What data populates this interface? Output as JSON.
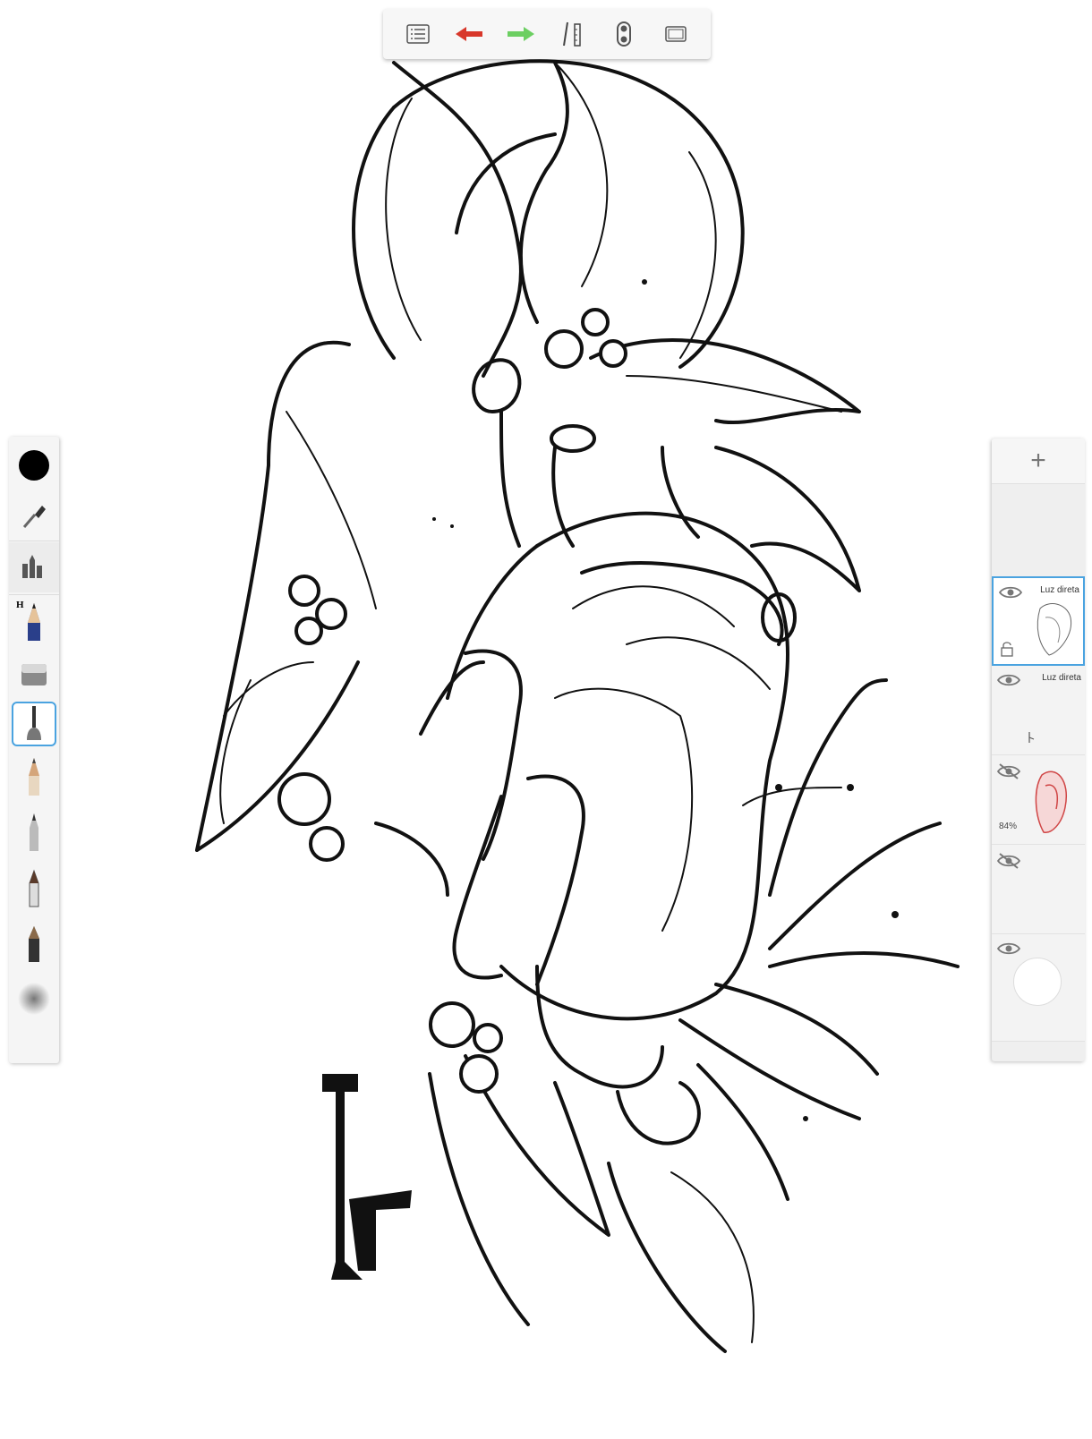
{
  "app": {
    "accent_color": "#4aa3e0"
  },
  "top_toolbar": {
    "buttons": [
      {
        "name": "list-icon"
      },
      {
        "name": "undo-arrow-icon",
        "color": "#d8372a"
      },
      {
        "name": "redo-arrow-icon",
        "color": "#6ccf62"
      },
      {
        "name": "ruler-icon"
      },
      {
        "name": "symmetry-icon"
      },
      {
        "name": "fullscreen-icon"
      }
    ]
  },
  "left_palette": {
    "color_swatch": "#000000",
    "pencil_hardness_label": "H"
  },
  "layers": [
    {
      "name": "Luz direta",
      "visible": true,
      "selected": true,
      "opacity": ""
    },
    {
      "name": "Luz direta",
      "visible": true,
      "selected": false,
      "opacity": ""
    },
    {
      "name": "",
      "visible": false,
      "selected": false,
      "opacity": "84%"
    },
    {
      "name": "",
      "visible": false,
      "selected": false,
      "opacity": ""
    },
    {
      "name": "",
      "visible": true,
      "selected": false,
      "opacity": ""
    }
  ],
  "add_layer_label": "+"
}
